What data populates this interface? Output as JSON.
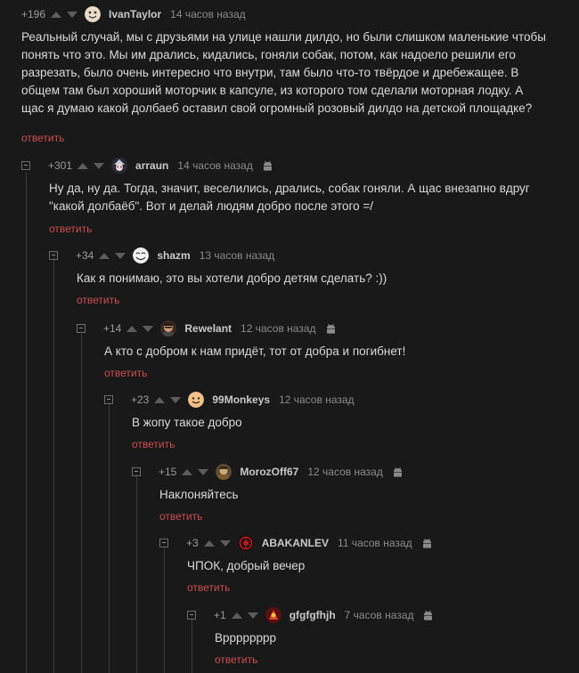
{
  "reply_label": "ответить",
  "accent_color": "#cc4d4d",
  "comments": [
    {
      "rating": "+196",
      "user": "IvanTaylor",
      "time": "14 часов назад",
      "avatar_icon": "meme-face-avatar",
      "android": false,
      "text": [
        "Реальный случай, мы с друзьями на улице нашли дилдо, но были слишком маленькие чтобы",
        "понять что это. Мы им дрались, кидались, гоняли собак, потом, как надоело решили его",
        "разрезать, было очень интересно что внутри, там было что-то твёрдое и дребежащее. В",
        "общем там был хороший моторчик в капсуле, из которого том сделали моторная лодку. А",
        "щас я думаю какой долбаеб оставил свой огромный розовый дилдо на детской площадке?"
      ]
    },
    {
      "rating": "+301",
      "user": "arraun",
      "time": "14 часов назад",
      "avatar_icon": "anime-avatar",
      "android": true,
      "text": [
        "Ну да, ну да. Тогда, значит, веселились, дрались, собак гоняли. А щас внезапно вдруг",
        "\"какой долбаёб\". Вот и делай людям добро после этого =/"
      ]
    },
    {
      "rating": "+34",
      "user": "shazm",
      "time": "13 часов назад",
      "avatar_icon": "troll-face-avatar",
      "android": false,
      "text": [
        "Как я понимаю, это вы хотели добро детям сделать? :))"
      ]
    },
    {
      "rating": "+14",
      "user": "Rewelant",
      "time": "12 часов назад",
      "avatar_icon": "man-avatar",
      "android": true,
      "text": [
        "А кто с добром к нам придёт, тот от добра и погибнет!"
      ]
    },
    {
      "rating": "+23",
      "user": "99Monkeys",
      "time": "12 часов назад",
      "avatar_icon": "smiley-avatar",
      "android": false,
      "text": [
        "В жопу такое добро"
      ]
    },
    {
      "rating": "+15",
      "user": "MorozOff67",
      "time": "12 часов назад",
      "avatar_icon": "portrait-avatar",
      "android": true,
      "text": [
        "Наклоняйтесь"
      ]
    },
    {
      "rating": "+3",
      "user": "ABAKANLEV",
      "time": "11 часов назад",
      "avatar_icon": "red-emblem-avatar",
      "android": true,
      "text": [
        "ЧПОК, добрый вечер"
      ]
    },
    {
      "rating": "+1",
      "user": "gfgfgfhjh",
      "time": "7 часов назад",
      "avatar_icon": "red-character-avatar",
      "android": true,
      "text": [
        "Врррррррр"
      ]
    }
  ]
}
